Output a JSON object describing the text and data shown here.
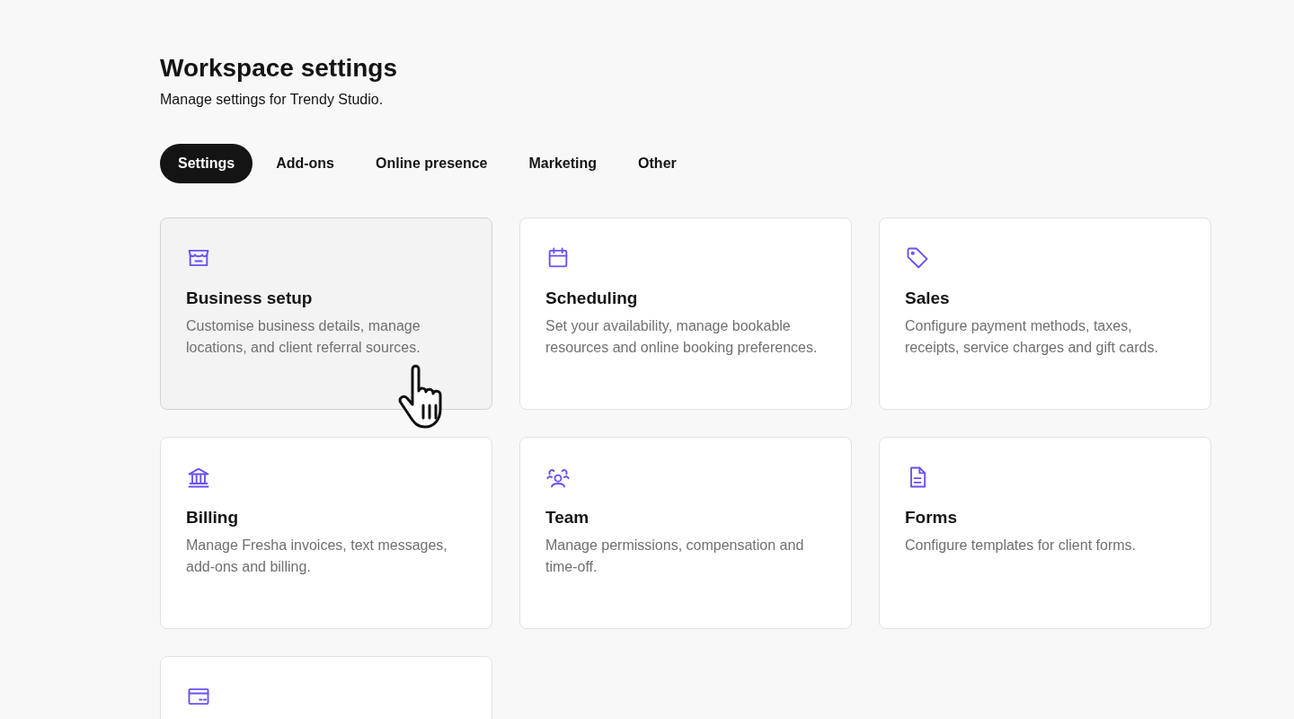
{
  "header": {
    "title": "Workspace settings",
    "subtitle": "Manage settings for Trendy Studio."
  },
  "tabs": [
    {
      "label": "Settings",
      "selected": true
    },
    {
      "label": "Add-ons",
      "selected": false
    },
    {
      "label": "Online presence",
      "selected": false
    },
    {
      "label": "Marketing",
      "selected": false
    },
    {
      "label": "Other",
      "selected": false
    }
  ],
  "cards": [
    {
      "title": "Business setup",
      "description": "Customise business details, manage locations, and client referral sources.",
      "hovered": true
    },
    {
      "title": "Scheduling",
      "description": "Set your availability, manage bookable resources and online booking preferences.",
      "hovered": false
    },
    {
      "title": "Sales",
      "description": "Configure payment methods, taxes, receipts, service charges and gift cards.",
      "hovered": false
    },
    {
      "title": "Billing",
      "description": "Manage Fresha invoices, text messages, add-ons and billing.",
      "hovered": false
    },
    {
      "title": "Team",
      "description": "Manage permissions, compensation and time-off.",
      "hovered": false
    },
    {
      "title": "Forms",
      "description": "Configure templates for client forms.",
      "hovered": false
    },
    {
      "hovered": false
    }
  ]
}
